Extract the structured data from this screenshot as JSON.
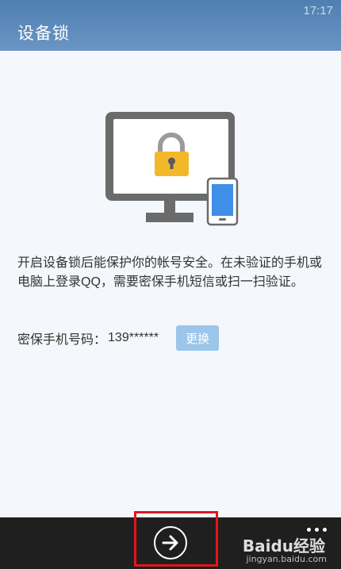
{
  "status_bar": {
    "time": "17:17"
  },
  "header": {
    "title": "设备锁"
  },
  "illustration": {
    "icons": [
      "monitor-icon",
      "padlock-icon",
      "smartphone-icon"
    ],
    "colors": {
      "lock": "#f3b72a",
      "phone_screen": "#3f8ee8",
      "monitor_frame": "#6b6b6b"
    }
  },
  "main": {
    "description": "开启设备锁后能保护你的帐号安全。在未验证的手机或电脑上登录QQ，需要密保手机短信或扫一扫验证。",
    "phone_label": "密保手机号码：",
    "phone_value": "139******",
    "change_button_label": "更换"
  },
  "app_bar": {
    "next_icon": "arrow-right-circle-icon",
    "more_icon": "ellipsis-icon",
    "watermark": "Baidu经验",
    "watermark_sub": "jingyan.baidu.com"
  },
  "colors": {
    "header": "#5b88b8",
    "accent_button": "#9cc5ea",
    "app_bar": "#1f1f1f",
    "highlight": "#e3151b"
  }
}
